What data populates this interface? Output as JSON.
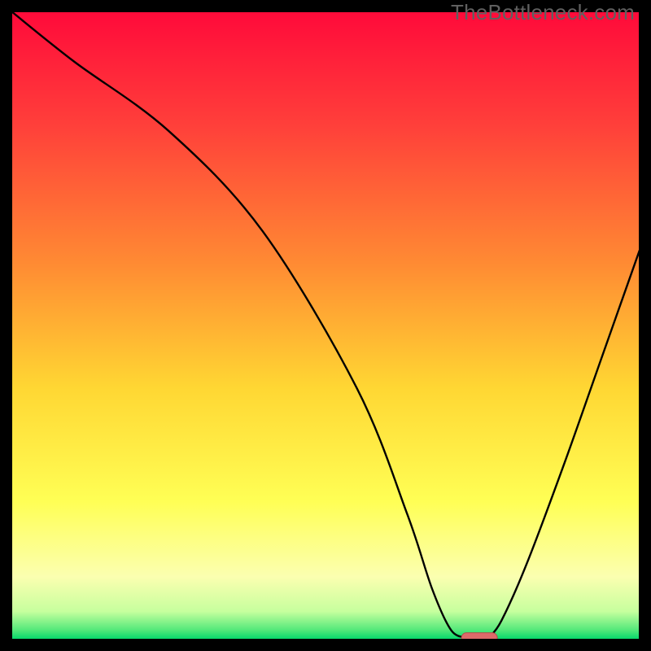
{
  "watermark": "TheBottleneck.com",
  "colors": {
    "black": "#000000",
    "curve": "#000000",
    "marker_fill": "#dd6a6a",
    "marker_stroke": "#b94a4a"
  },
  "chart_data": {
    "type": "line",
    "title": "",
    "xlabel": "",
    "ylabel": "",
    "xlim": [
      0,
      100
    ],
    "ylim": [
      0,
      100
    ],
    "grid": false,
    "legend": false,
    "series": [
      {
        "name": "bottleneck-curve-left",
        "x": [
          0,
          10,
          25,
          40,
          55,
          63,
          67,
          70,
          72.5
        ],
        "values": [
          100,
          92,
          81,
          65,
          40,
          20,
          8,
          1.5,
          0.3
        ]
      },
      {
        "name": "bottleneck-curve-right",
        "x": [
          76,
          78,
          82,
          88,
          94,
          100
        ],
        "values": [
          0.3,
          3,
          12,
          28,
          45,
          62
        ]
      }
    ],
    "annotations": [
      {
        "name": "optimum-marker",
        "x": 74.5,
        "y": 0.3
      }
    ],
    "background_gradient": {
      "stops": [
        {
          "pos": 0.0,
          "color": "#ff0a3a"
        },
        {
          "pos": 0.18,
          "color": "#ff3f3a"
        },
        {
          "pos": 0.4,
          "color": "#ff8a33"
        },
        {
          "pos": 0.6,
          "color": "#ffd733"
        },
        {
          "pos": 0.78,
          "color": "#ffff55"
        },
        {
          "pos": 0.9,
          "color": "#fbffb0"
        },
        {
          "pos": 0.955,
          "color": "#c7ff9e"
        },
        {
          "pos": 0.985,
          "color": "#52e87a"
        },
        {
          "pos": 1.0,
          "color": "#00d66a"
        }
      ]
    }
  }
}
